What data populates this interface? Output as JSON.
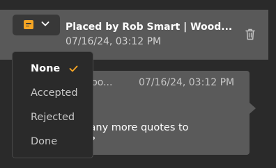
{
  "header": {
    "title": "Placed by Rob Smart | Wood...",
    "timestamp": "07/16/24, 03:12 PM"
  },
  "status_button": {
    "icon": "note-icon",
    "icon_color": "#f5a524",
    "chevron": "chevron-down-icon"
  },
  "delete_icon": "trash-icon",
  "message": {
    "sender": "| Woo...",
    "timestamp": "07/16/24, 03:12 PM",
    "text": "e any more quotes to\nm?"
  },
  "status_menu": {
    "selected": "None",
    "check_color": "#f5a524",
    "options": [
      {
        "label": "None"
      },
      {
        "label": "Accepted"
      },
      {
        "label": "Rejected"
      },
      {
        "label": "Done"
      }
    ]
  }
}
